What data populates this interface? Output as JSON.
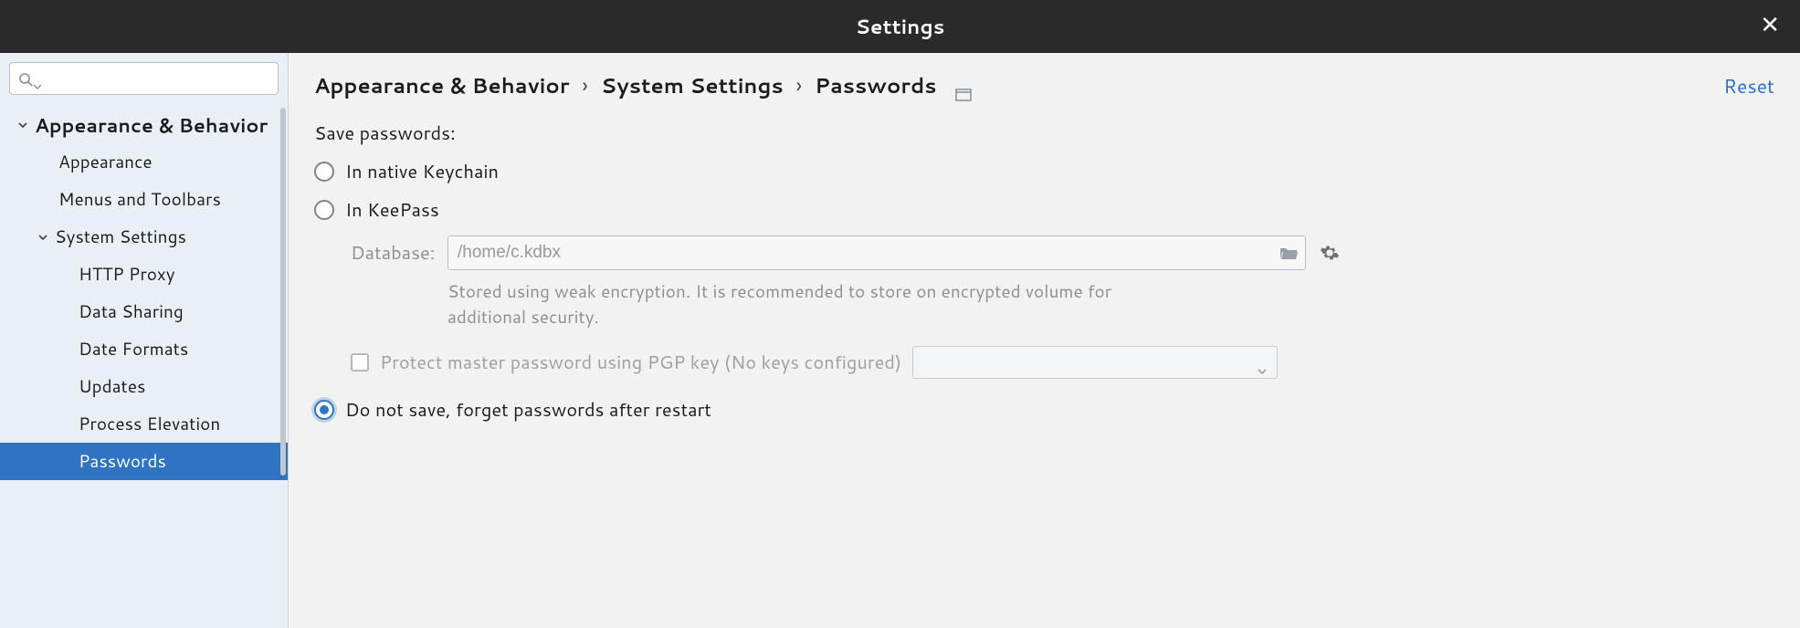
{
  "window": {
    "title": "Settings"
  },
  "sidebar": {
    "search_placeholder": "",
    "items": [
      {
        "label": "Appearance & Behavior"
      },
      {
        "label": "Appearance"
      },
      {
        "label": "Menus and Toolbars"
      },
      {
        "label": "System Settings"
      },
      {
        "label": "HTTP Proxy"
      },
      {
        "label": "Data Sharing"
      },
      {
        "label": "Date Formats"
      },
      {
        "label": "Updates"
      },
      {
        "label": "Process Elevation"
      },
      {
        "label": "Passwords"
      }
    ]
  },
  "breadcrumb": {
    "parts": [
      "Appearance & Behavior",
      "System Settings",
      "Passwords"
    ],
    "reset": "Reset"
  },
  "form": {
    "section_label": "Save passwords:",
    "radio_keychain": "In native Keychain",
    "radio_keepass": "In KeePass",
    "database_label": "Database:",
    "database_value": "/home/c.kdbx",
    "weak_hint": "Stored using weak encryption. It is recommended to store on encrypted volume for additional security.",
    "pgp_label": "Protect master password using PGP key (No keys configured)",
    "radio_donotsave": "Do not save, forget passwords after restart"
  }
}
